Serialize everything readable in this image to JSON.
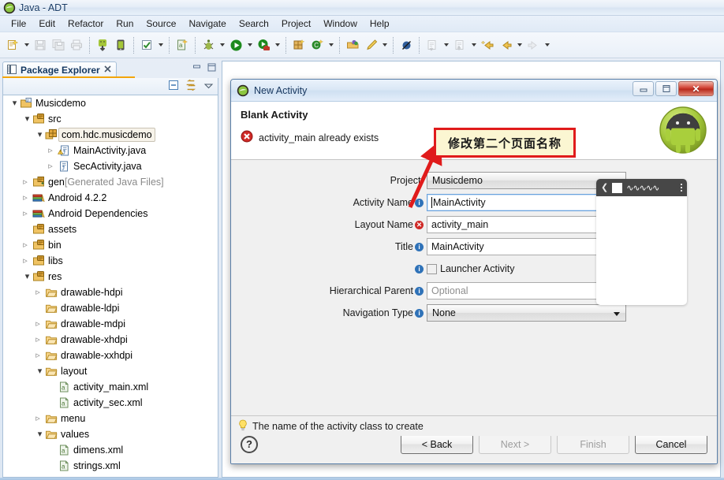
{
  "window": {
    "title": "Java - ADT",
    "icon": "eclipse-icon"
  },
  "menubar": {
    "items": [
      "File",
      "Edit",
      "Refactor",
      "Run",
      "Source",
      "Navigate",
      "Search",
      "Project",
      "Window",
      "Help"
    ]
  },
  "toolbar": {
    "groups": [
      {
        "items": [
          {
            "name": "new-wizard-icon",
            "kind": "icon",
            "glyph": "new",
            "enabled": true
          },
          {
            "name": "new-dropdown-arrow",
            "kind": "arrow"
          },
          {
            "name": "save-icon",
            "kind": "icon",
            "glyph": "save",
            "enabled": false
          },
          {
            "name": "save-all-icon",
            "kind": "icon",
            "glyph": "saveall",
            "enabled": false
          },
          {
            "name": "print-icon",
            "kind": "icon",
            "glyph": "print",
            "enabled": false
          }
        ]
      },
      {
        "items": [
          {
            "name": "android-sdk-manager-icon",
            "kind": "icon",
            "glyph": "android-green",
            "enabled": true
          },
          {
            "name": "android-virtual-device-manager-icon",
            "kind": "icon",
            "glyph": "avd",
            "enabled": true
          }
        ]
      },
      {
        "items": [
          {
            "name": "check-mark-icon",
            "kind": "icon",
            "glyph": "check",
            "enabled": true
          },
          {
            "name": "check-dropdown-arrow",
            "kind": "arrow"
          }
        ]
      },
      {
        "items": [
          {
            "name": "new-android-xml-file-icon",
            "kind": "icon",
            "glyph": "xmlfile",
            "enabled": true
          }
        ]
      },
      {
        "items": [
          {
            "name": "debug-icon",
            "kind": "icon",
            "glyph": "bug",
            "enabled": true
          },
          {
            "name": "debug-dropdown-arrow",
            "kind": "arrow"
          },
          {
            "name": "run-icon",
            "kind": "icon",
            "glyph": "run",
            "enabled": true
          },
          {
            "name": "run-dropdown-arrow",
            "kind": "arrow"
          },
          {
            "name": "run-external-tools-icon",
            "kind": "icon",
            "glyph": "runtools",
            "enabled": true
          },
          {
            "name": "external-tools-dropdown-arrow",
            "kind": "arrow"
          }
        ]
      },
      {
        "items": [
          {
            "name": "new-java-package-icon",
            "kind": "icon",
            "glyph": "package",
            "enabled": true
          },
          {
            "name": "new-java-class-icon",
            "kind": "icon",
            "glyph": "class",
            "enabled": true
          },
          {
            "name": "class-dropdown-arrow",
            "kind": "arrow"
          }
        ]
      },
      {
        "items": [
          {
            "name": "open-type-icon",
            "kind": "icon",
            "glyph": "opentype",
            "enabled": true
          },
          {
            "name": "search-pencil-icon",
            "kind": "icon",
            "glyph": "pencil",
            "enabled": true
          },
          {
            "name": "search-dropdown-arrow",
            "kind": "arrow"
          }
        ]
      },
      {
        "items": [
          {
            "name": "skip-all-breakpoints-icon",
            "kind": "icon",
            "glyph": "skipbp",
            "enabled": true
          }
        ]
      },
      {
        "items": [
          {
            "name": "previous-annotation-icon",
            "kind": "icon",
            "glyph": "prevannot",
            "enabled": false
          },
          {
            "name": "previous-annotation-dropdown-arrow",
            "kind": "arrow"
          },
          {
            "name": "next-annotation-icon",
            "kind": "icon",
            "glyph": "nextannot",
            "enabled": false
          },
          {
            "name": "next-annotation-dropdown-arrow",
            "kind": "arrow"
          },
          {
            "name": "last-edit-location-icon",
            "kind": "icon",
            "glyph": "lastedit",
            "enabled": true
          },
          {
            "name": "back-icon",
            "kind": "icon",
            "glyph": "back",
            "enabled": true
          },
          {
            "name": "back-dropdown-arrow",
            "kind": "arrow"
          },
          {
            "name": "forward-icon",
            "kind": "icon",
            "glyph": "forward",
            "enabled": false
          },
          {
            "name": "forward-dropdown-arrow",
            "kind": "arrow"
          }
        ]
      }
    ]
  },
  "package_explorer": {
    "tab_label": "Package Explorer",
    "close_icon": "close-icon",
    "view_icon": "package-explorer-icon",
    "minimize_icon": "minimize-icon",
    "maximize_icon": "maximize-icon",
    "toolbar": [
      {
        "name": "collapse-all-icon",
        "label": "collapse-all"
      },
      {
        "name": "link-with-editor-icon",
        "label": "link-with-editor"
      },
      {
        "name": "view-menu-icon",
        "label": "view-menu"
      }
    ],
    "tree": [
      {
        "label": "Musicdemo",
        "indent": 0,
        "twisty": "open",
        "icon": "java-project-icon",
        "selected": false
      },
      {
        "label": "src",
        "indent": 1,
        "twisty": "open",
        "icon": "source-folder-icon",
        "selected": false
      },
      {
        "label": "com.hdc.musicdemo",
        "indent": 2,
        "twisty": "open",
        "icon": "package-icon",
        "selected": true
      },
      {
        "label": "MainActivity.java",
        "indent": 3,
        "twisty": "closed",
        "icon": "java-file-warning-icon",
        "selected": false
      },
      {
        "label": "SecActivity.java",
        "indent": 3,
        "twisty": "closed",
        "icon": "java-file-icon",
        "selected": false
      },
      {
        "label": "gen ",
        "indent": 1,
        "twisty": "closed",
        "icon": "gen-folder-icon",
        "selected": false,
        "suffix": "[Generated Java Files]"
      },
      {
        "label": "Android 4.2.2",
        "indent": 1,
        "twisty": "closed",
        "icon": "library-icon",
        "selected": false
      },
      {
        "label": "Android Dependencies",
        "indent": 1,
        "twisty": "closed",
        "icon": "library-icon",
        "selected": false
      },
      {
        "label": "assets",
        "indent": 1,
        "twisty": "none",
        "icon": "folder-icon",
        "selected": false
      },
      {
        "label": "bin",
        "indent": 1,
        "twisty": "closed",
        "icon": "folder-icon",
        "selected": false
      },
      {
        "label": "libs",
        "indent": 1,
        "twisty": "closed",
        "icon": "folder-icon",
        "selected": false
      },
      {
        "label": "res",
        "indent": 1,
        "twisty": "open",
        "icon": "folder-icon",
        "selected": false
      },
      {
        "label": "drawable-hdpi",
        "indent": 2,
        "twisty": "closed",
        "icon": "plain-folder-icon",
        "selected": false
      },
      {
        "label": "drawable-ldpi",
        "indent": 2,
        "twisty": "none",
        "icon": "plain-folder-icon",
        "selected": false
      },
      {
        "label": "drawable-mdpi",
        "indent": 2,
        "twisty": "closed",
        "icon": "plain-folder-icon",
        "selected": false
      },
      {
        "label": "drawable-xhdpi",
        "indent": 2,
        "twisty": "closed",
        "icon": "plain-folder-icon",
        "selected": false
      },
      {
        "label": "drawable-xxhdpi",
        "indent": 2,
        "twisty": "closed",
        "icon": "plain-folder-icon",
        "selected": false
      },
      {
        "label": "layout",
        "indent": 2,
        "twisty": "open",
        "icon": "plain-folder-icon",
        "selected": false
      },
      {
        "label": "activity_main.xml",
        "indent": 3,
        "twisty": "none",
        "icon": "android-xml-icon",
        "selected": false
      },
      {
        "label": "activity_sec.xml",
        "indent": 3,
        "twisty": "none",
        "icon": "android-xml-icon",
        "selected": false
      },
      {
        "label": "menu",
        "indent": 2,
        "twisty": "closed",
        "icon": "plain-folder-icon",
        "selected": false
      },
      {
        "label": "values",
        "indent": 2,
        "twisty": "open",
        "icon": "plain-folder-icon",
        "selected": false
      },
      {
        "label": "dimens.xml",
        "indent": 3,
        "twisty": "none",
        "icon": "android-xml-icon",
        "selected": false
      },
      {
        "label": "strings.xml",
        "indent": 3,
        "twisty": "none",
        "icon": "android-xml-icon",
        "selected": false
      }
    ]
  },
  "dialog": {
    "title": "New Activity",
    "title_icon": "eclipse-wizard-icon",
    "window_buttons": {
      "minimize": "minimize-icon",
      "maximize": "maximize-icon",
      "close": "close-icon"
    },
    "header": {
      "heading": "Blank Activity",
      "error_icon": "error-icon",
      "error_message": "activity_main already exists",
      "logo": "android-robot-logo"
    },
    "fields": [
      {
        "name": "project",
        "label": "Project:",
        "badge": "none",
        "control": "combo",
        "value": "Musicdemo"
      },
      {
        "name": "activity-name",
        "label": "Activity Name",
        "badge": "info",
        "control": "text",
        "value": "MainActivity",
        "focused": true
      },
      {
        "name": "layout-name",
        "label": "Layout Name",
        "badge": "error",
        "control": "text",
        "value": "activity_main",
        "focused": false
      },
      {
        "name": "title",
        "label": "Title",
        "badge": "info",
        "control": "text",
        "value": "MainActivity",
        "focused": false
      },
      {
        "name": "launcher-activity",
        "label": "",
        "badge": "info",
        "control": "checkbox",
        "checkbox_label": "Launcher Activity",
        "checked": false
      },
      {
        "name": "hierarchical-parent",
        "label": "Hierarchical Parent",
        "badge": "info",
        "control": "text-browse",
        "value": "",
        "placeholder": "Optional",
        "browse_label": "..."
      },
      {
        "name": "navigation-type",
        "label": "Navigation Type",
        "badge": "info",
        "control": "combo",
        "value": "None"
      }
    ],
    "preview": {
      "name": "activity-preview",
      "back_glyph": "❮",
      "zigzag": "∿∿∿∿∿",
      "overflow_icon": "overflow-menu-icon"
    },
    "hint": {
      "icon": "lightbulb-icon",
      "text": "The name of the activity class to create"
    },
    "footer": {
      "help_label": "?",
      "buttons": [
        {
          "name": "back-button",
          "label": "< Back",
          "enabled": true
        },
        {
          "name": "next-button",
          "label": "Next >",
          "enabled": false
        },
        {
          "name": "finish-button",
          "label": "Finish",
          "enabled": false
        },
        {
          "name": "cancel-button",
          "label": "Cancel",
          "enabled": true
        }
      ]
    }
  },
  "annotation": {
    "text": "修改第二个页面名称",
    "box_color": "#e01b1b",
    "fill_color": "#fbf6d2",
    "arrow_color": "#e01b1b"
  }
}
